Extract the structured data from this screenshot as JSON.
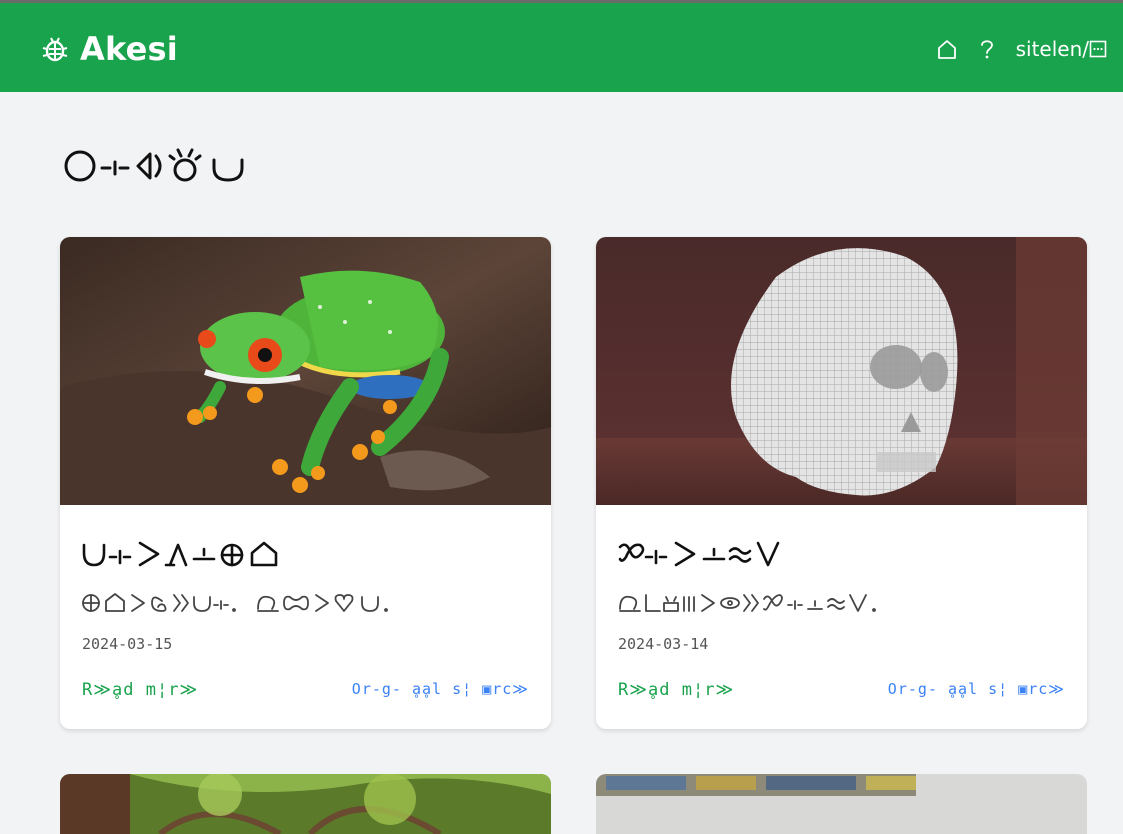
{
  "app": {
    "brand_name": "Akesi",
    "nav_login_text": "sitelen/",
    "accent": "#19a34d",
    "link_color": "#3b82f6"
  },
  "icons": {
    "brand": "beetle-icon",
    "home": "home-icon",
    "help": "question-icon",
    "login": "login-box-icon"
  },
  "cards": [
    {
      "date": "2024-03-15",
      "read_more_label": "R≫ḁd m¦r≫",
      "original_label": "Or-g- ḁḁl s¦ ▣rc≫",
      "image": "green tree frog"
    },
    {
      "date": "2024-03-14",
      "read_more_label": "R≫ḁd m¦r≫",
      "original_label": "Or-g- ḁḁl s¦ ▣rc≫",
      "image": "3d printed lattice skull"
    }
  ]
}
